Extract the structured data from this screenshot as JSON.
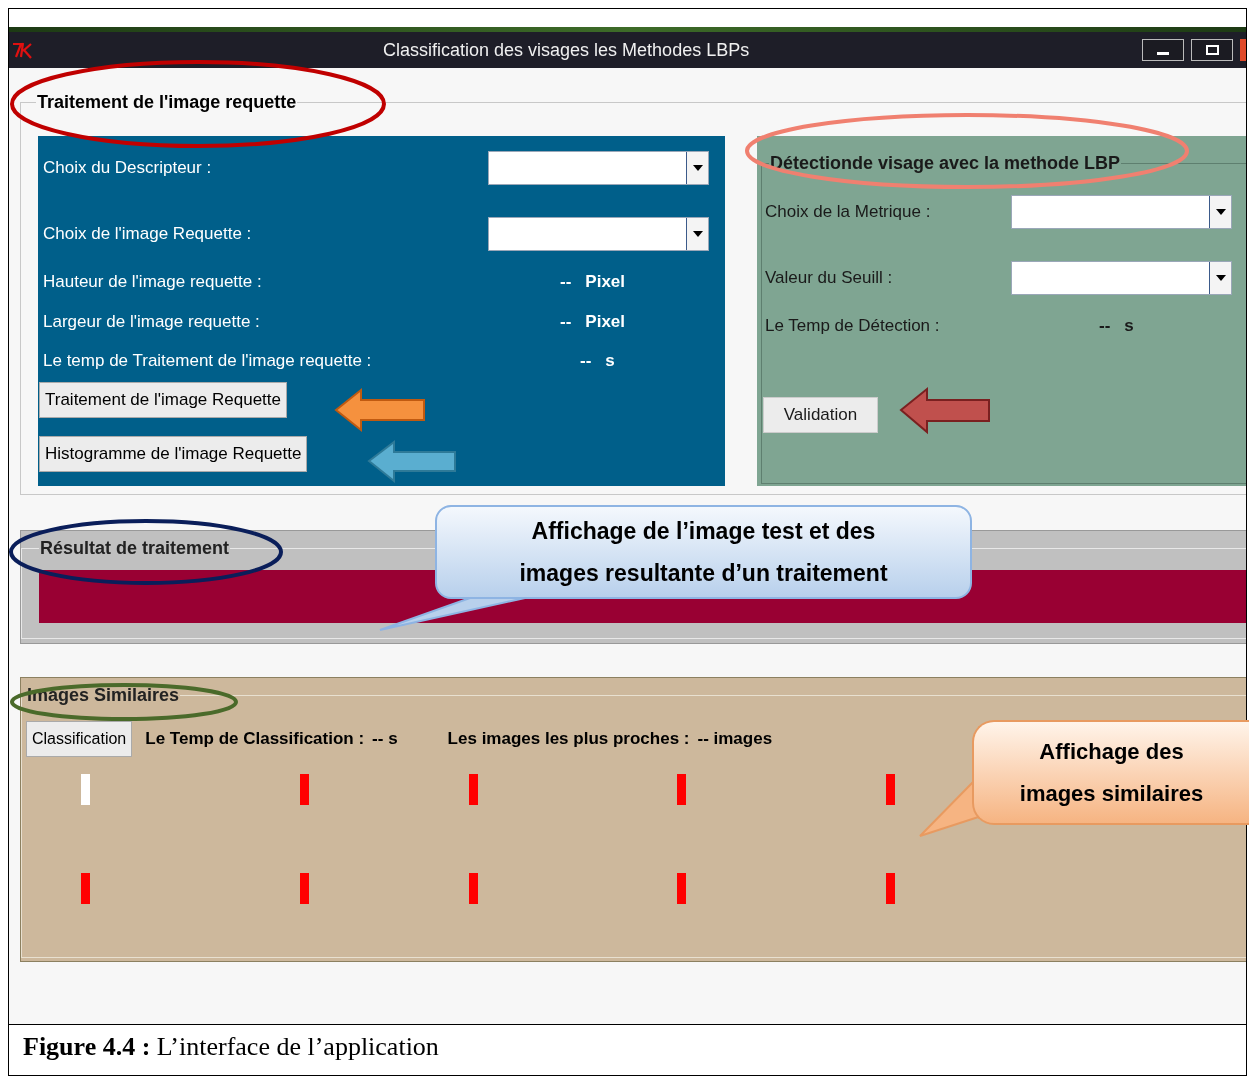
{
  "window": {
    "title": "Classification des visages les Methodes LBPs"
  },
  "query_group": {
    "title": "Traitement de l'image requette",
    "selects": [
      {
        "label": "Choix du Descripteur :"
      },
      {
        "label": "Choix de l'image Requette :"
      }
    ],
    "readouts": [
      {
        "label": "Hauteur de l'image requette :",
        "value": "--",
        "unit": "Pixel"
      },
      {
        "label": "Largeur de l'image requette :",
        "value": "--",
        "unit": "Pixel"
      },
      {
        "label": "Le temp de Traitement de l'image requette :",
        "value": "--",
        "unit": "s"
      }
    ],
    "buttons": [
      "Traitement de l'image Requette",
      "Histogramme de l'image Requette"
    ]
  },
  "detection_group": {
    "title": "Détectionde visage avec la methode LBP",
    "selects": [
      {
        "label": "Choix de la Metrique :"
      },
      {
        "label": "Valeur du Seuill :"
      }
    ],
    "readouts": [
      {
        "label": "Le Temp de Détection :",
        "value": "--",
        "unit": "s"
      }
    ],
    "button": "Validation"
  },
  "result_group": {
    "title": "Résultat de traitement"
  },
  "similar_group": {
    "title": "Images Similaires",
    "button": "Classification",
    "stats": [
      {
        "label": "Le Temp de Classification :",
        "value": "-- s"
      },
      {
        "label": "Les images les plus proches :",
        "value": "-- images"
      }
    ],
    "thumbnails": [
      [
        {
          "color": "#ffffff"
        },
        {
          "color": "#ff0000"
        },
        {
          "color": "#ff0000"
        },
        {
          "color": "#ff0000"
        },
        {
          "color": "#ff0000"
        }
      ],
      [
        {
          "color": "#ff0000"
        },
        {
          "color": "#ff0000"
        },
        {
          "color": "#ff0000"
        },
        {
          "color": "#ff0000"
        },
        {
          "color": "#ff0000"
        }
      ]
    ]
  },
  "callouts": [
    {
      "lines": [
        "Affichage de l’image test et des",
        "images resultante d’un traitement"
      ]
    },
    {
      "lines": [
        "Affichage des",
        "images similaires"
      ]
    }
  ],
  "caption": "**Figure 4.4 :** L’interface de l’application"
}
